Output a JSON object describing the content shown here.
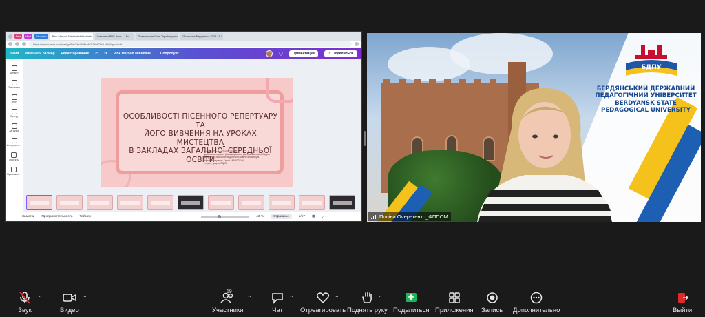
{
  "browser": {
    "tabs": [
      "Pink Maroon Minimalist Aesthetic…",
      "Сніжинки/PDF-docs — Ес…",
      "Презентація Пісні Україна ранок…",
      "Програма Бердянськ 2025 18.1…"
    ],
    "chips": [
      {
        "label": "Dela",
        "color": "#e0407a"
      },
      {
        "label": "Mont",
        "color": "#c43ad7"
      },
      {
        "label": "Education",
        "color": "#2b7de1"
      }
    ],
    "url": "https://www.canva.com/design/DAGkxYMRwAO/1YMCbQ-H8xWpyz/edit"
  },
  "canva": {
    "menu": {
      "file": "Файл",
      "resize": "Изменить размер",
      "edit": "Редактирование",
      "doc_title": "Pink Maroon Minimalis…",
      "try": "Попробуйт…",
      "present": "Презентация",
      "share": "Поделиться"
    },
    "sidebar": [
      "Дизайн",
      "Элементы",
      "Текст",
      "Бренд",
      "Загрузки",
      "Инструмен…",
      "Проекты",
      "Приложен…"
    ],
    "slide": {
      "title_lines": [
        "ОСОБЛИВОСТІ ПІСЕННОГО РЕПЕРТУАРУ ТА",
        "ЙОГО ВИВЧЕННЯ  НА УРОКАХ МИСТЕЦТВА",
        "В ЗАКЛАДАХ ЗАГАЛЬНОЇ СЕРЕДНЬОЇ ОСВІТИ"
      ],
      "author_lines": [
        "доповідач Поліна ОЧЕРЕТЕНКО,",
        "здобувачка першого (бакалаврського) рівня вищої освіти 3 курсу",
        "факультету психолого-педагогічної освіти та мистецтв",
        "Науковий керівник: Ганна ЗАБОЛОТНА,",
        "к.пед.н., доцент ЯДВП"
      ]
    },
    "bottom": {
      "notes": "Заметки",
      "duration": "Продолжительность",
      "timer": "Таймер",
      "zoom": "43 %",
      "pages": "Страницы",
      "page_count": "1/17"
    }
  },
  "video": {
    "participant": "Поліна Очеретенко_ФППОМ",
    "logo_text": "БДПУ",
    "university_lines": [
      "БЕРДЯНСЬКИЙ ДЕРЖАВНИЙ",
      "ПЕДАГОГІЧНИЙ УНІВЕРСИТЕТ",
      "BERDYANSK STATE",
      "PEDAGOGICAL UNIVERSITY"
    ]
  },
  "toolbar": {
    "audio": "Звук",
    "video": "Видео",
    "participants": "Участники",
    "participants_count": "19",
    "chat": "Чат",
    "react": "Отреагировать",
    "raise_hand": "Поднять руку",
    "share": "Поделиться",
    "apps": "Приложения",
    "record": "Запись",
    "more": "Дополнительно",
    "leave": "Выйти"
  },
  "colors": {
    "share_green": "#1fb35b",
    "leave_red": "#e0282d",
    "canva_gradient_start": "#1fb7c6",
    "canva_gradient_end": "#7b2fd0"
  }
}
